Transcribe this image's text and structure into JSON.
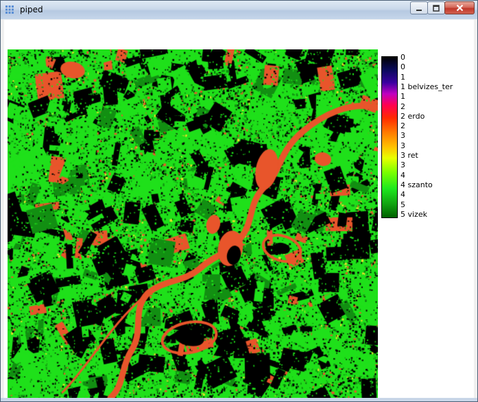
{
  "window": {
    "title": "piped",
    "minimize_icon": "minimize-icon",
    "maximize_icon": "maximize-icon",
    "close_icon": "close-icon"
  },
  "colors": {
    "black": "#000000",
    "green": "#1fe01a",
    "dark_green": "#128f12",
    "orange": "#e8552b",
    "yellow": "#e8e028"
  },
  "legend": {
    "ticks": [
      "0",
      "0",
      "1",
      "1 belvizes_ter",
      "1",
      "2",
      "2 erdo",
      "2",
      "3",
      "3",
      "3 ret",
      "3",
      "4",
      "4 szanto",
      "4",
      "5",
      "5 vizek"
    ]
  }
}
